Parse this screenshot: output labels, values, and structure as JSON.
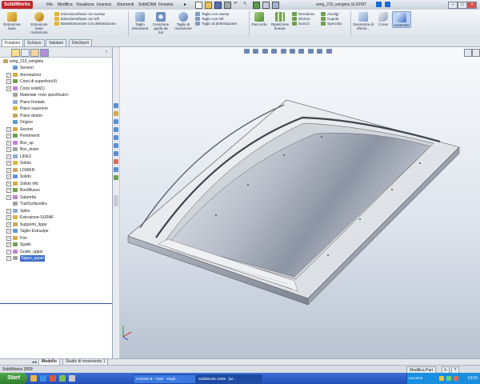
{
  "app": {
    "logo": "SolidWorks",
    "menus": [
      "File",
      "Modifica",
      "Visualizza",
      "Inserisci",
      "Strumenti",
      "SolidCAM",
      "Finestra"
    ],
    "window_title": "wing_210_winglets.SLDPRT"
  },
  "ribbon": {
    "large_buttons": [
      {
        "label": "Estrusione base"
      },
      {
        "label": "Estrusione base rivoluzione"
      },
      {
        "label": "Taglio estrusione"
      },
      {
        "label": "Creazione guida da fori"
      },
      {
        "label": "Taglio di rivoluzione"
      },
      {
        "label": "Raccordo"
      },
      {
        "label": "Ripetizione lineare"
      },
      {
        "label": "Geometria di riferim..."
      },
      {
        "label": "Curve"
      },
      {
        "label": "Instant3D"
      }
    ],
    "small_buttons": [
      {
        "label": "Estrusione/base con sweep"
      },
      {
        "label": "Estrusione/base con loft"
      },
      {
        "label": "Base/Estrusione con delimitazione"
      },
      {
        "label": "Taglio con sweep"
      },
      {
        "label": "Taglio con loft"
      },
      {
        "label": "Taglio di delimitazione"
      },
      {
        "label": "Nervatura"
      },
      {
        "label": "Sformo"
      },
      {
        "label": "Guscio"
      },
      {
        "label": "Avvolgi"
      },
      {
        "label": "Cupola"
      },
      {
        "label": "Specchio"
      }
    ]
  },
  "tabs": [
    "Funzioni",
    "Schizzo",
    "Valutare",
    "DimXpert"
  ],
  "tree": {
    "root": "wing_210_winglets",
    "items": [
      {
        "label": "Sensori",
        "expand": false
      },
      {
        "label": "Annotazioni",
        "expand": true
      },
      {
        "label": "Corpi di superficie(4)",
        "expand": true
      },
      {
        "label": "Corpi solidi(1)",
        "expand": true
      },
      {
        "label": "Materiale <non specificato>",
        "expand": false
      },
      {
        "label": "Piano frontale",
        "expand": false
      },
      {
        "label": "Piano superiore",
        "expand": false
      },
      {
        "label": "Piano destro",
        "expand": false
      },
      {
        "label": "Origine",
        "expand": false
      },
      {
        "label": "Sezioni",
        "expand": true
      },
      {
        "label": "Pertdrnenti",
        "expand": true
      },
      {
        "label": "Box_up",
        "expand": true
      },
      {
        "label": "Box_down",
        "expand": true
      },
      {
        "label": "LIRE3",
        "expand": true
      },
      {
        "label": "Solido",
        "expand": true
      },
      {
        "label": "LOWER",
        "expand": true
      },
      {
        "label": "Solido",
        "expand": true
      },
      {
        "label": "Solido riflt.",
        "expand": true
      },
      {
        "label": "Bordiflusso",
        "expand": true
      },
      {
        "label": "Salaretta",
        "expand": true
      },
      {
        "label": "TrailSurfaceitru",
        "expand": false
      },
      {
        "label": "Spike",
        "expand": true
      },
      {
        "label": "Estrusione-SURAF",
        "expand": true
      },
      {
        "label": "Supporto_lippe",
        "expand": true
      },
      {
        "label": "Taglio-Estrusipe",
        "expand": true
      },
      {
        "label": "Fori",
        "expand": true
      },
      {
        "label": "Spalle",
        "expand": true
      },
      {
        "label": "Guide_upper",
        "expand": true
      },
      {
        "label": "Tappo_upper",
        "expand": true
      }
    ],
    "selected_index": 28
  },
  "model_tabs": [
    "Modello",
    "Studio di movimento 1"
  ],
  "status": {
    "left": "SolidWorks 2009",
    "right": "Modifica Part",
    "help": "?"
  },
  "taskbar": {
    "start": "Start",
    "tasks": [
      "CADDO B - Tutor - Repli...",
      "SolidWorks 2009 - [wi..."
    ],
    "active_index": 1,
    "tray_label": "Leconne",
    "clock": "13:03"
  }
}
